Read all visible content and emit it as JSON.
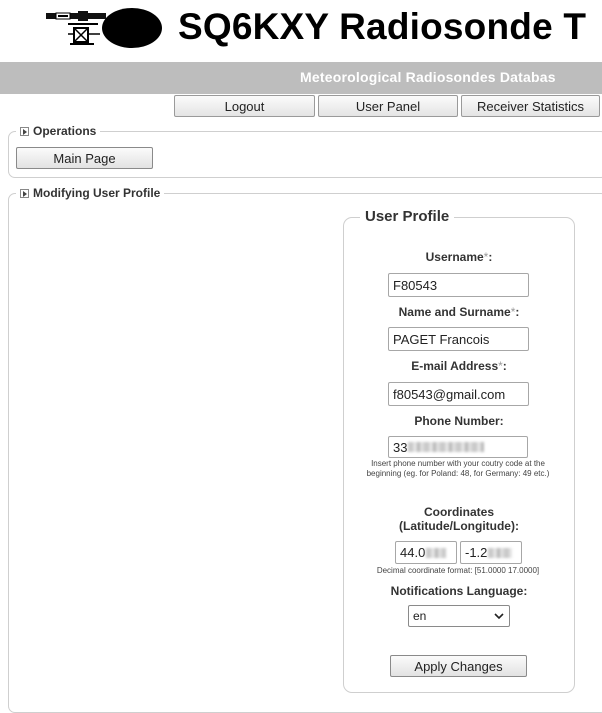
{
  "header": {
    "title": "SQ6KXY Radiosonde T",
    "subtitle": "Meteorological Radiosondes Databas"
  },
  "nav": {
    "logout": "Logout",
    "user_panel": "User Panel",
    "receiver_statistics": "Receiver Statistics"
  },
  "operations": {
    "legend": "Operations",
    "main_page": "Main Page"
  },
  "modify": {
    "legend": "Modifying User Profile"
  },
  "profile": {
    "legend": "User Profile",
    "username_label": "Username",
    "username_value": "F80543",
    "name_label": "Name and Surname",
    "name_value": "PAGET Francois",
    "email_label": "E-mail Address",
    "email_value": "f80543@gmail.com",
    "phone_label": "Phone Number:",
    "phone_value": "33",
    "phone_hint": "Insert phone number with your coutry code at the beginning (eg. for Poland: 48, for Germany: 49 etc.)",
    "coords_label_1": "Coordinates",
    "coords_label_2": "(Latitude/Longitude):",
    "lat_value": "44.0",
    "lon_value": "-1.2",
    "coords_hint": "Decimal coordinate format: [51.0000 17.0000]",
    "lang_label": "Notifications Language:",
    "lang_value": "en",
    "apply": "Apply Changes",
    "required_mark": "*",
    "colon": ":"
  }
}
